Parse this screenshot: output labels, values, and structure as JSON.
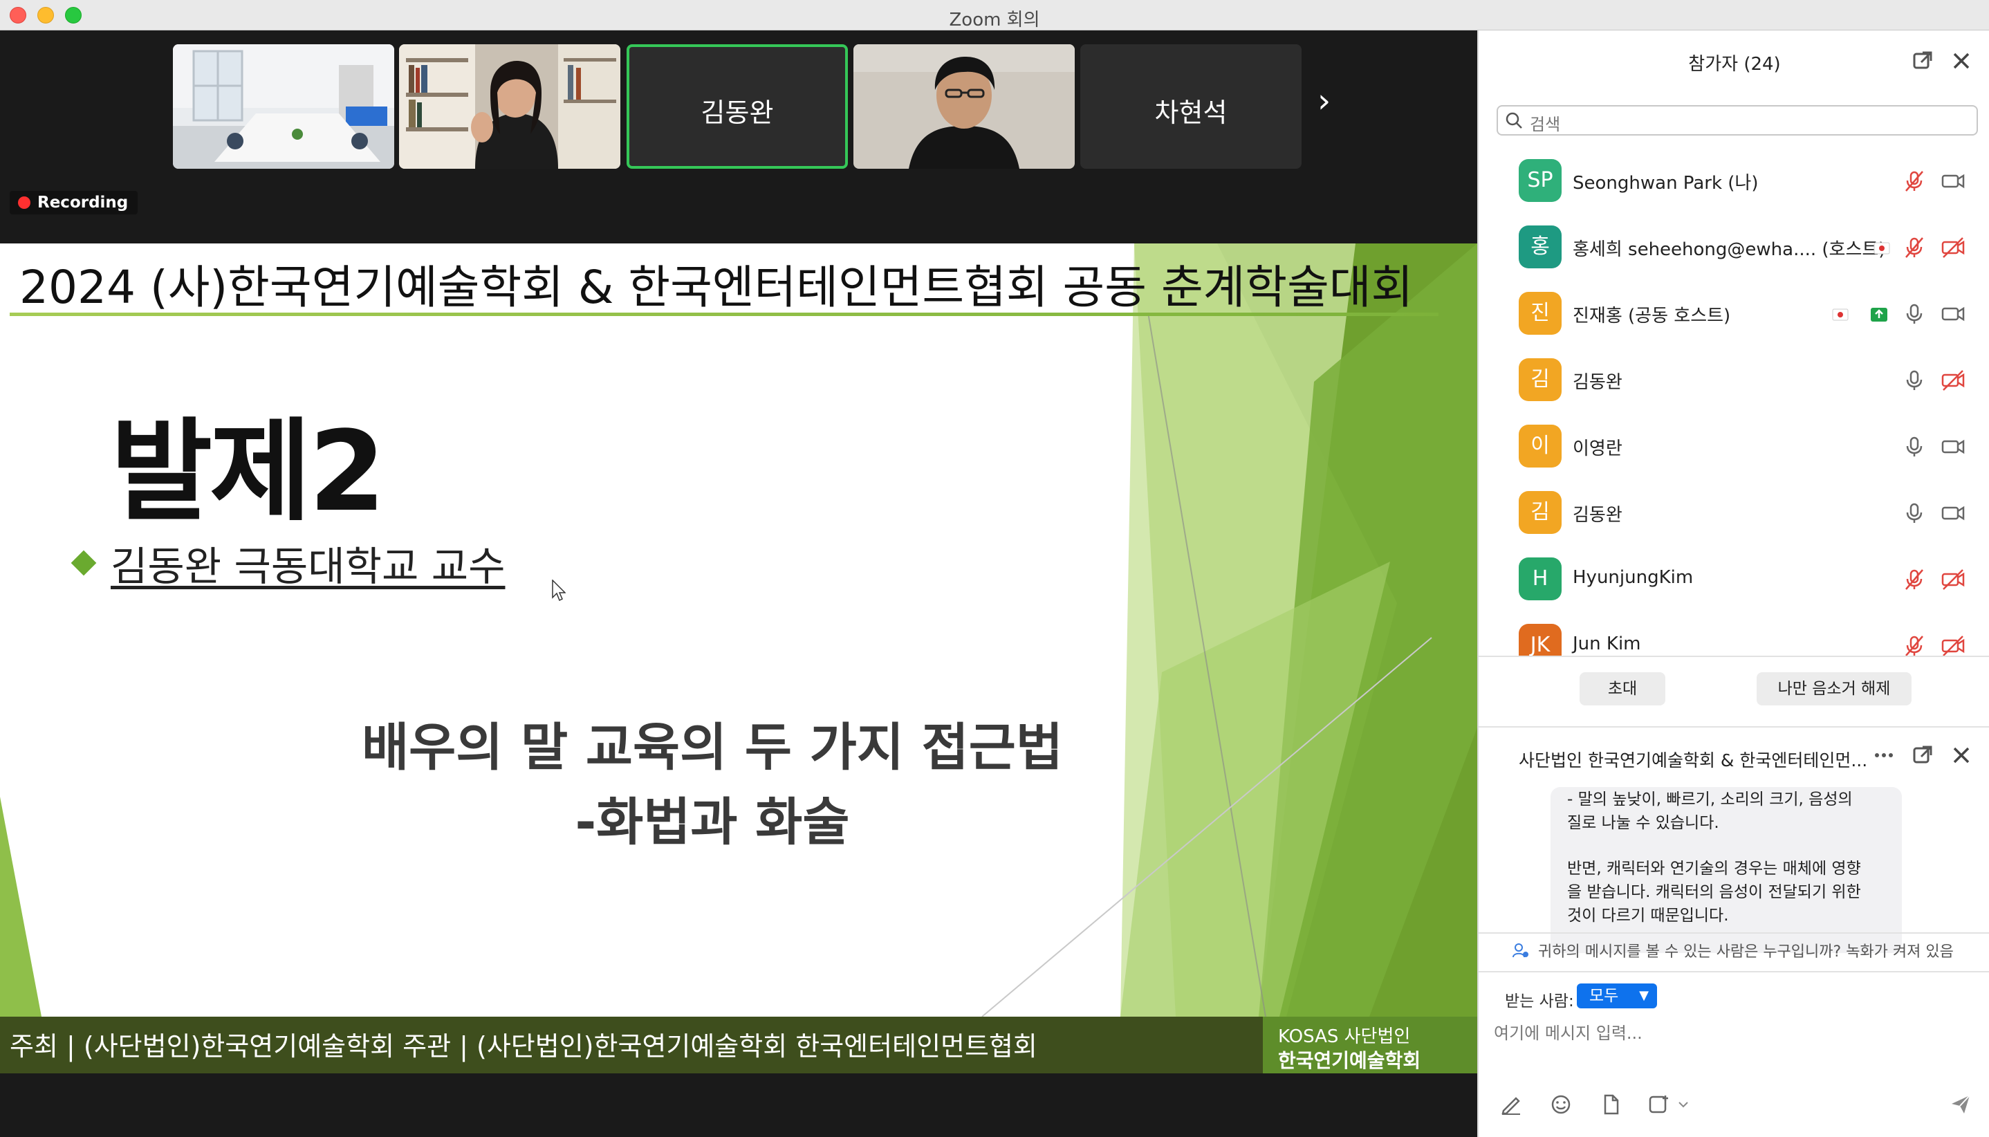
{
  "window": {
    "title": "Zoom 회의"
  },
  "gallery": {
    "tiles": [
      {
        "kind": "video",
        "scene": "meeting-room"
      },
      {
        "kind": "video",
        "scene": "bookshelf-woman"
      },
      {
        "kind": "name",
        "name": "김동완",
        "active": true
      },
      {
        "kind": "video",
        "scene": "man-portrait"
      },
      {
        "kind": "name",
        "name": "차현석",
        "active": false
      }
    ],
    "next_icon": "chevron-right-icon"
  },
  "recording": {
    "label": "Recording"
  },
  "slide": {
    "heading": "2024 (사)한국연기예술학회 & 한국엔터테인먼트협회 공동 춘계학술대회",
    "title": "발제2",
    "presenter": "김동완 극동대학교 교수",
    "topic_line1": "배우의 말 교육의 두 가지 접근법",
    "topic_line2": "-화법과 화술",
    "footer": "주최 | (사단법인)한국연기예술학회   주관 | (사단법인)한국연기예술학회   한국엔터테인먼트협회",
    "logo_top": "KOSAS 사단법인",
    "logo_bottom": "한국연기예술학회"
  },
  "participants_panel": {
    "title": "참가자 (24)",
    "search_placeholder": "검색",
    "participants": [
      {
        "initials": "SP",
        "name": "Seonghwan Park (나)",
        "avatar_color": "#2fb07a",
        "mic_muted": true,
        "video_off": false
      },
      {
        "initials": "홍",
        "name": "홍세희 seheehong@ewha....  (호스트)",
        "avatar_color": "#1e9a82",
        "mic_muted": true,
        "video_off": true,
        "flag": true
      },
      {
        "initials": "진",
        "name": "진재홍 (공동 호스트)",
        "avatar_color": "#f2a623",
        "mic_muted": false,
        "video_off": false,
        "flag": true,
        "share": true
      },
      {
        "initials": "김",
        "name": "김동완",
        "avatar_color": "#f2a623",
        "mic_muted": false,
        "video_off": true
      },
      {
        "initials": "이",
        "name": "이영란",
        "avatar_color": "#f2a623",
        "mic_muted": false,
        "video_off": false
      },
      {
        "initials": "김",
        "name": "김동완",
        "avatar_color": "#f2a623",
        "mic_muted": false,
        "video_off": false
      },
      {
        "initials": "H",
        "name": "HyunjungKim",
        "avatar_color": "#27a86a",
        "mic_muted": true,
        "video_off": true
      },
      {
        "initials": "JK",
        "name": "Jun Kim",
        "avatar_color": "#e06b1f",
        "mic_muted": true,
        "video_off": true
      }
    ],
    "invite_label": "초대",
    "unmute_label": "나만 음소거 해제"
  },
  "chat": {
    "title": "사단법인 한국연기예술학회 & 한국엔터테인먼...",
    "message_line1": "- 말의 높낮이, 빠르기, 소리의 크기, 음성의",
    "message_line2": "질로 나눌 수 있습니다.",
    "message_line3": "반면, 캐릭터와 연기술의 경우는 매체에 영향",
    "message_line4": "을 받습니다. 캐릭터의 음성이 전달되기 위한",
    "message_line5": "것이 다르기 때문입니다.",
    "privacy_notice": "귀하의 메시지를 볼 수 있는 사람은 누구입니까? 녹화가 켜져 있음",
    "to_label": "받는 사람:",
    "to_value": "모두",
    "input_placeholder": "여기에 메시지 입력..."
  },
  "colors": {
    "accent_green": "#35c758",
    "recording_red": "#ff3030",
    "zoom_blue": "#0e72ed",
    "muted_red": "#e0463f"
  }
}
